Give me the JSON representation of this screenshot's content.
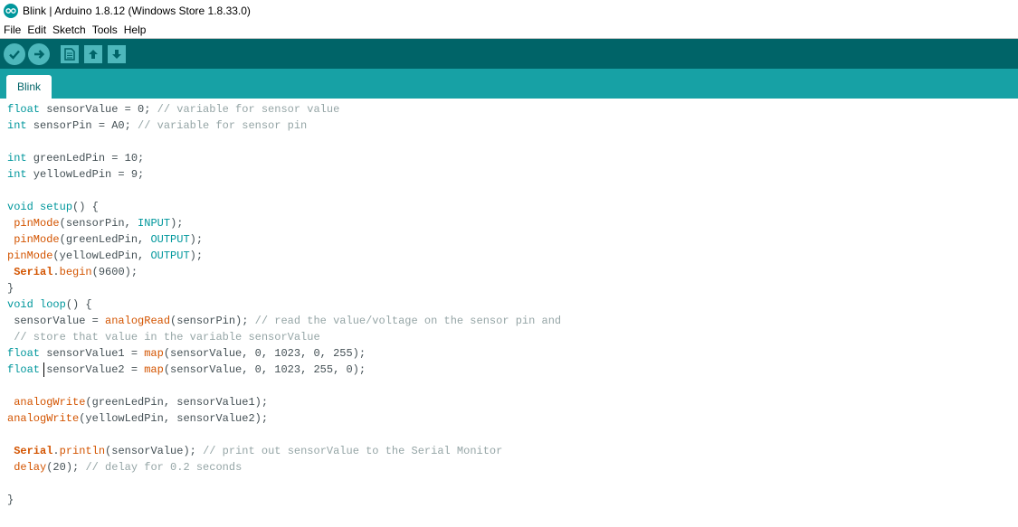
{
  "window": {
    "title": "Blink | Arduino 1.8.12 (Windows Store 1.8.33.0)"
  },
  "menu": {
    "items": [
      "File",
      "Edit",
      "Sketch",
      "Tools",
      "Help"
    ]
  },
  "toolbar": {
    "buttons": [
      {
        "icon": "verify-checkmark-icon"
      },
      {
        "icon": "upload-arrow-icon"
      },
      {
        "icon": "new-sketch-icon"
      },
      {
        "icon": "open-sketch-icon"
      },
      {
        "icon": "save-sketch-icon"
      }
    ]
  },
  "tabs": [
    {
      "label": "Blink"
    }
  ],
  "colors": {
    "keyword": "#00979c",
    "function": "#d35400",
    "comment": "#95a5a6",
    "toolbar": "#006468",
    "tabbar": "#17a1a5"
  },
  "code": {
    "lines": [
      [
        {
          "t": "float",
          "c": "kw"
        },
        {
          "t": " sensorValue = 0; "
        },
        {
          "t": "// variable for sensor value",
          "c": "cm"
        }
      ],
      [
        {
          "t": "int",
          "c": "kw"
        },
        {
          "t": " sensorPin = A0; "
        },
        {
          "t": "// variable for sensor pin",
          "c": "cm"
        }
      ],
      [],
      [
        {
          "t": "int",
          "c": "kw"
        },
        {
          "t": " greenLedPin = 10;"
        }
      ],
      [
        {
          "t": "int",
          "c": "kw"
        },
        {
          "t": " yellowLedPin = 9;"
        }
      ],
      [],
      [
        {
          "t": "void",
          "c": "kw"
        },
        {
          "t": " "
        },
        {
          "t": "setup",
          "c": "kw"
        },
        {
          "t": "() {"
        }
      ],
      [
        {
          "t": " "
        },
        {
          "t": "pinMode",
          "c": "fn"
        },
        {
          "t": "(sensorPin, "
        },
        {
          "t": "INPUT",
          "c": "const"
        },
        {
          "t": ");"
        }
      ],
      [
        {
          "t": " "
        },
        {
          "t": "pinMode",
          "c": "fn"
        },
        {
          "t": "(greenLedPin, "
        },
        {
          "t": "OUTPUT",
          "c": "const"
        },
        {
          "t": ");"
        }
      ],
      [
        {
          "t": "pinMode",
          "c": "fn"
        },
        {
          "t": "(yellowLedPin, "
        },
        {
          "t": "OUTPUT",
          "c": "const"
        },
        {
          "t": ");"
        }
      ],
      [
        {
          "t": " "
        },
        {
          "t": "Serial",
          "c": "cls"
        },
        {
          "t": "."
        },
        {
          "t": "begin",
          "c": "fn"
        },
        {
          "t": "(9600);"
        }
      ],
      [
        {
          "t": "}"
        }
      ],
      [
        {
          "t": "void",
          "c": "kw"
        },
        {
          "t": " "
        },
        {
          "t": "loop",
          "c": "kw"
        },
        {
          "t": "() {"
        }
      ],
      [
        {
          "t": " sensorValue = "
        },
        {
          "t": "analogRead",
          "c": "fn"
        },
        {
          "t": "(sensorPin); "
        },
        {
          "t": "// read the value/voltage on the sensor pin and",
          "c": "cm"
        }
      ],
      [
        {
          "t": " "
        },
        {
          "t": "// store that value in the variable sensorValue",
          "c": "cm"
        }
      ],
      [
        {
          "t": "float",
          "c": "kw"
        },
        {
          "t": " sensorValue1 = "
        },
        {
          "t": "map",
          "c": "fn"
        },
        {
          "t": "(sensorValue, 0, 1023, 0, 255);"
        }
      ],
      [
        {
          "t": "float",
          "c": "kw"
        },
        {
          "t": " sensorValue2 = "
        },
        {
          "t": "map",
          "c": "fn"
        },
        {
          "t": "(sensorValue, 0, 1023, 255, 0);"
        }
      ],
      [],
      [
        {
          "t": " "
        },
        {
          "t": "analogWrite",
          "c": "fn"
        },
        {
          "t": "(greenLedPin, sensorValue1);"
        }
      ],
      [
        {
          "t": "analogWrite",
          "c": "fn"
        },
        {
          "t": "(yellowLedPin, sensorValue2);"
        }
      ],
      [],
      [
        {
          "t": " "
        },
        {
          "t": "Serial",
          "c": "cls"
        },
        {
          "t": "."
        },
        {
          "t": "println",
          "c": "fn"
        },
        {
          "t": "(sensorValue); "
        },
        {
          "t": "// print out sensorValue to the Serial Monitor",
          "c": "cm"
        }
      ],
      [
        {
          "t": " "
        },
        {
          "t": "delay",
          "c": "fn"
        },
        {
          "t": "(20); "
        },
        {
          "t": "// delay for 0.2 seconds",
          "c": "cm"
        }
      ],
      [],
      [
        {
          "t": "}"
        }
      ]
    ]
  }
}
